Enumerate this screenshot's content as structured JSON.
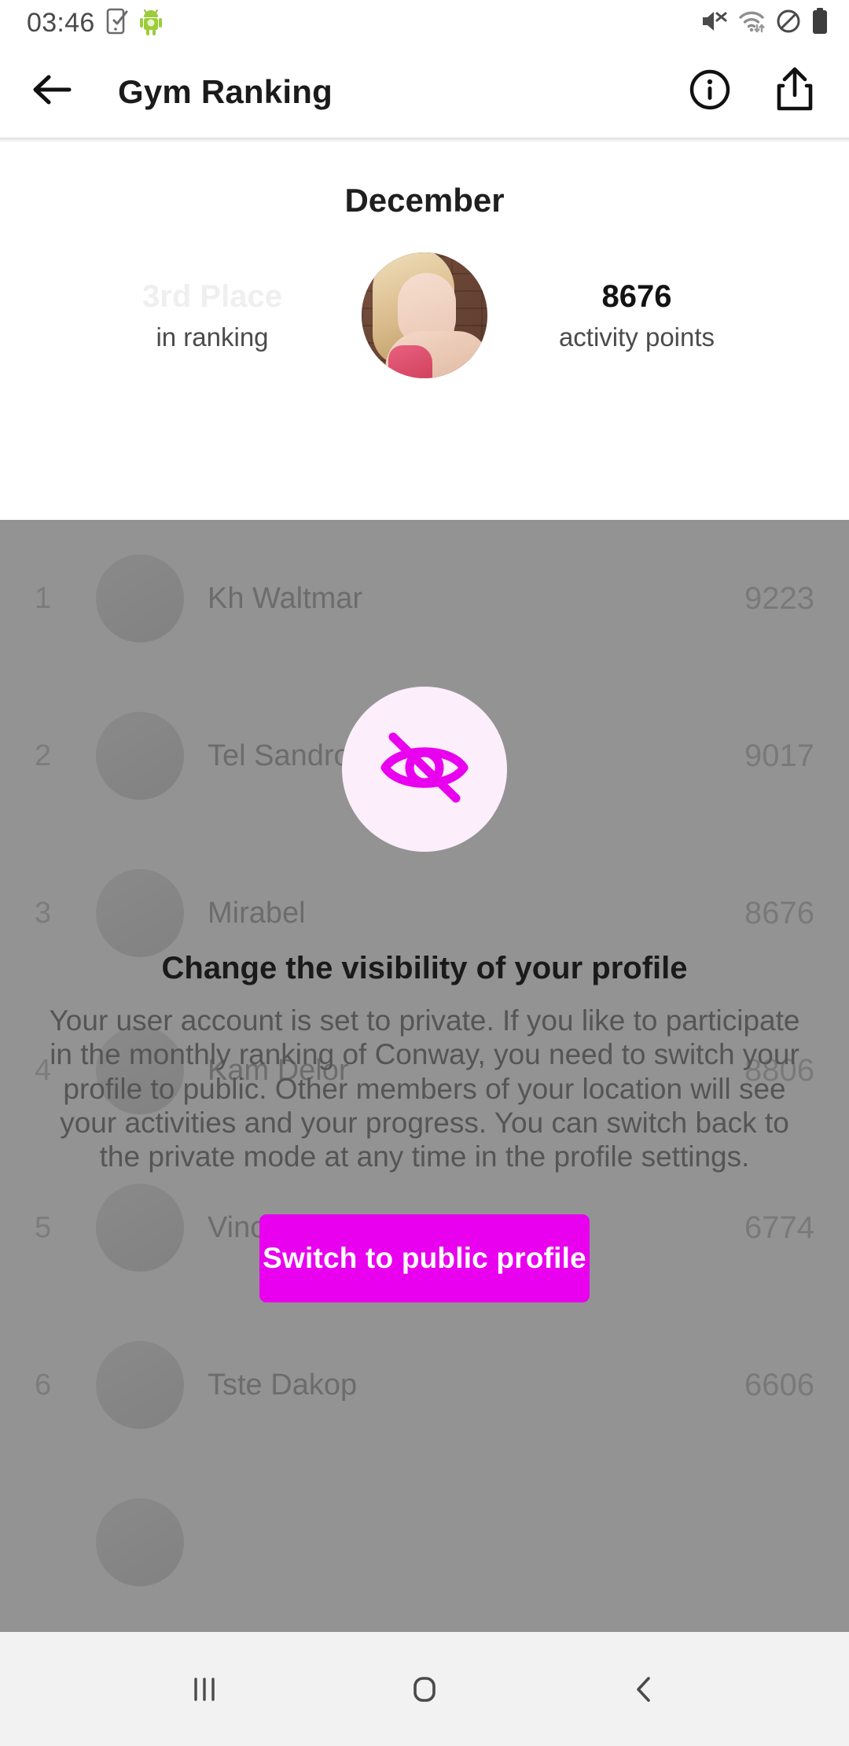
{
  "status_bar": {
    "time": "03:46",
    "left_icons": [
      "screenshot-capture-icon",
      "android-mascot-icon"
    ],
    "right_icons": [
      "mute-icon",
      "wifi-icon",
      "do-not-disturb-icon",
      "battery-icon"
    ]
  },
  "app_bar": {
    "back_label": "back-arrow",
    "title": "Gym Ranking",
    "info_label": "info",
    "share_label": "share"
  },
  "summary": {
    "month": "December",
    "rank_value": "3rd Place",
    "rank_caption": "in ranking",
    "points_value": "8676",
    "points_caption": "activity points",
    "avatar_label": "user-avatar"
  },
  "ranking": {
    "rows": [
      {
        "pos": "1",
        "name": "Kh Waltmar",
        "points": "9223"
      },
      {
        "pos": "2",
        "name": "Tel Sandro",
        "points": "9017"
      },
      {
        "pos": "3",
        "name": "Mirabel",
        "points": "8676"
      },
      {
        "pos": "4",
        "name": "Kam Delor",
        "points": "8806"
      },
      {
        "pos": "5",
        "name": "Vincent Owen",
        "points": "6774"
      },
      {
        "pos": "6",
        "name": "Tste Dakop",
        "points": "6606"
      }
    ]
  },
  "modal": {
    "icon": "eye-off-icon",
    "title": "Change the visibility of your profile",
    "body": "Your user account is set to private. If you like to participate in the monthly ranking of Conway, you need to switch your profile to public. Other members of your location will see your activities and your progress. You can switch back to the private mode at any time in the profile settings.",
    "button_label": "Switch to public profile"
  },
  "nav_bar": {
    "recents_label": "recents",
    "home_label": "home",
    "back_label": "back"
  },
  "colors": {
    "accent": "#e800ef",
    "icon_bg": "#fceefb",
    "overlay": "#787878",
    "status_text": "#4a4a4a"
  }
}
